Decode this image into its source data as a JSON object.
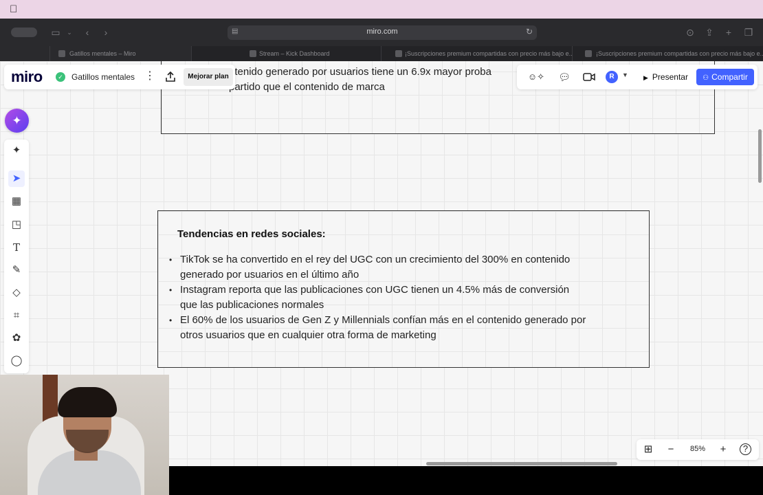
{
  "browser": {
    "url": "miro.com",
    "tabs": [
      {
        "title": "Gatillos mentales – Miro",
        "active": true
      },
      {
        "title": "Stream – Kick Dashboard",
        "active": false
      },
      {
        "title": "¡Suscripciones premium compartidas con precio más bajo e...",
        "active": false
      },
      {
        "title": "¡Suscripciones premium compartidas con precio más bajo e...",
        "active": false
      }
    ]
  },
  "miro": {
    "logo": "miro",
    "board_name": "Gatillos mentales",
    "upgrade_label": "Mejorar plan",
    "present_label": "Presentar",
    "share_label": "Compartir",
    "avatar_initial": "R",
    "zoom": "85%"
  },
  "frames": {
    "top": {
      "line1": "ntenido generado por usuarios tiene un 6.9x mayor proba",
      "line2": "partido que el contenido de marca"
    },
    "main": {
      "title": "Tendencias en redes sociales:",
      "bullets": [
        {
          "line1": "TikTok se ha convertido en el rey del UGC con un crecimiento del 300% en contenido",
          "line2": "generado por usuarios en el último año"
        },
        {
          "line1": "Instagram reporta que las publicaciones con UGC tienen un 4.5% más de conversión",
          "line2": "que las publicaciones normales"
        },
        {
          "line1": "El 60% de los usuarios de Gen Z y Millennials confían más en el contenido generado por",
          "line2": "otros usuarios que en cualquier otra forma de marketing"
        }
      ]
    }
  },
  "icons": {
    "left_toolbar": [
      "ai-sparkle-icon",
      "select-cursor-icon",
      "templates-icon",
      "sticky-note-icon",
      "text-icon",
      "pen-icon",
      "shapes-icon",
      "frame-icon",
      "stamp-icon",
      "comment-icon"
    ],
    "right_panel": [
      "reactions-icon",
      "chat-icon",
      "video-icon"
    ]
  },
  "colors": {
    "accent": "#4262ff",
    "board_bg": "#f6f6f6",
    "browser_chrome": "#2a2a2d",
    "menubar": "#ecd5e6"
  }
}
